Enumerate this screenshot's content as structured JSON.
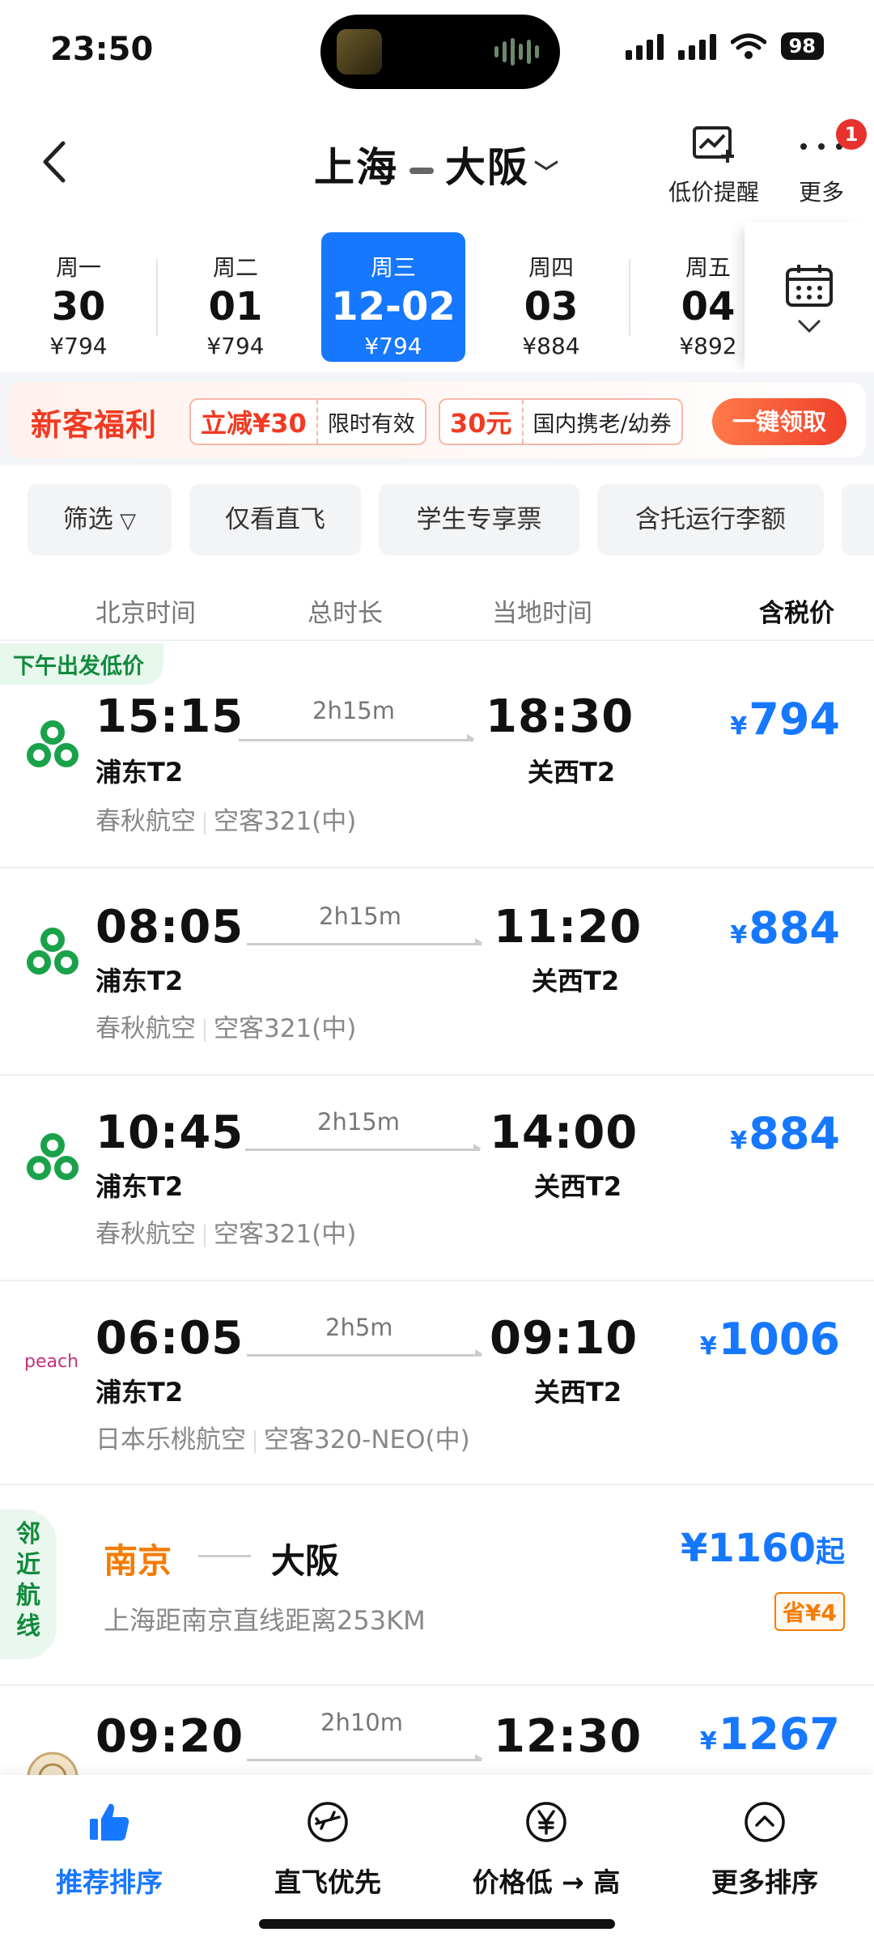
{
  "status_bar": {
    "time": "23:50",
    "battery": "98"
  },
  "header": {
    "origin": "上海",
    "destination": "大阪",
    "price_alert_label": "低价提醒",
    "more_label": "更多",
    "more_badge": "1"
  },
  "dates": [
    {
      "weekday": "周一",
      "day": "30",
      "price": "¥794"
    },
    {
      "weekday": "周二",
      "day": "01",
      "price": "¥794"
    },
    {
      "weekday": "周三",
      "day": "12-02",
      "price": "¥794",
      "selected": true
    },
    {
      "weekday": "周四",
      "day": "03",
      "price": "¥884"
    },
    {
      "weekday": "周五",
      "day": "04",
      "price": "¥892"
    }
  ],
  "promo": {
    "title": "新客福利",
    "coupon1_amount": "立减¥30",
    "coupon1_desc": "限时有效",
    "coupon2_amount": "30元",
    "coupon2_desc": "国内携老/幼券",
    "claim_label": "一键领取"
  },
  "filters": [
    "筛选",
    "仅看直飞",
    "学生专享票",
    "含托运行李额"
  ],
  "columns": {
    "dep": "北京时间",
    "duration": "总时长",
    "arr": "当地时间",
    "price": "含税价"
  },
  "flights": [
    {
      "tag": "下午出发低价",
      "dep_time": "15:15",
      "dep_term": "浦东T2",
      "duration": "2h15m",
      "arr_time": "18:30",
      "arr_term": "关西T2",
      "airline": "春秋航空",
      "aircraft": "空客321(中)",
      "price": "794",
      "logo": "spring-airlines-icon"
    },
    {
      "dep_time": "08:05",
      "dep_term": "浦东T2",
      "duration": "2h15m",
      "arr_time": "11:20",
      "arr_term": "关西T2",
      "airline": "春秋航空",
      "aircraft": "空客321(中)",
      "price": "884",
      "logo": "spring-airlines-icon"
    },
    {
      "dep_time": "10:45",
      "dep_term": "浦东T2",
      "duration": "2h15m",
      "arr_time": "14:00",
      "arr_term": "关西T2",
      "airline": "春秋航空",
      "aircraft": "空客321(中)",
      "price": "884",
      "logo": "spring-airlines-icon"
    },
    {
      "dep_time": "06:05",
      "dep_term": "浦东T2",
      "duration": "2h5m",
      "arr_time": "09:10",
      "arr_term": "关西T2",
      "airline": "日本乐桃航空",
      "aircraft": "空客320-NEO(中)",
      "price": "1006",
      "logo": "peach-aviation-icon",
      "logo_text": "peach"
    },
    {
      "dep_time": "09:20",
      "duration": "2h10m",
      "arr_time": "12:30",
      "price": "1267",
      "logo": "airline-emblem-icon"
    }
  ],
  "nearby": {
    "tag": "邻近航线",
    "from": "南京",
    "to": "大阪",
    "desc": "上海距南京直线距离253KM",
    "price": "¥1160",
    "price_suffix": "起",
    "save": "省¥4"
  },
  "bottom_nav": [
    {
      "label": "推荐排序",
      "icon": "thumbs-up-icon",
      "active": true
    },
    {
      "label": "直飞优先",
      "icon": "airplane-circle-icon"
    },
    {
      "label": "价格低 → 高",
      "icon": "yen-circle-icon"
    },
    {
      "label": "更多排序",
      "icon": "chevron-up-circle-icon"
    }
  ],
  "colors": {
    "accent": "#1677ff",
    "promo_red": "#f03a22",
    "green": "#128a3c",
    "orange": "#f57c00"
  }
}
